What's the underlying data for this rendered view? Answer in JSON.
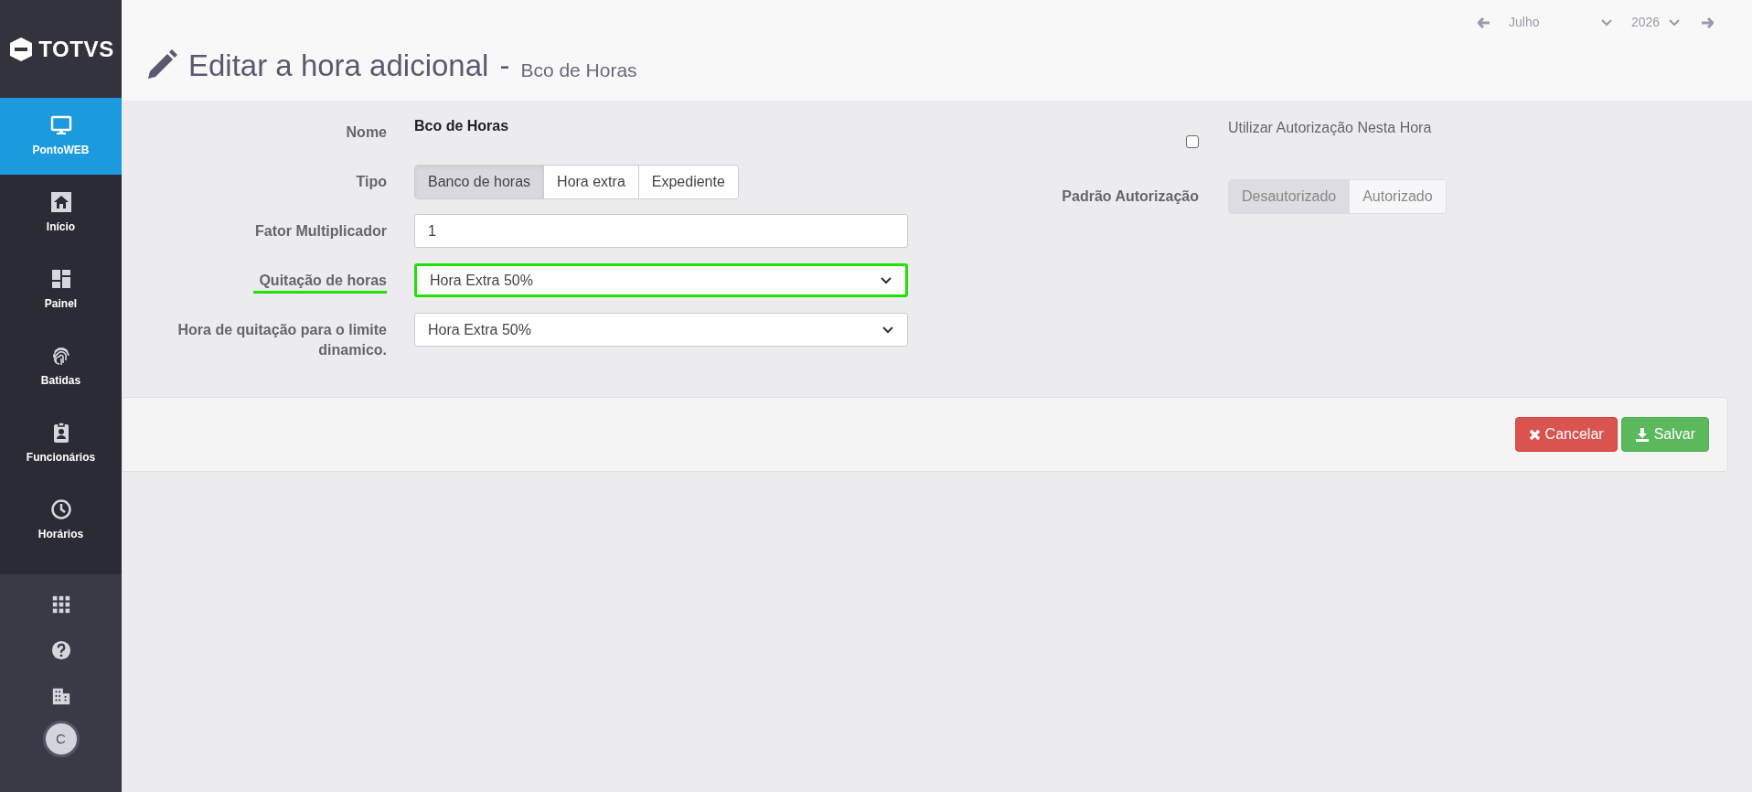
{
  "sidebar": {
    "logo": "TOTVS",
    "items": [
      {
        "label": "PontoWEB",
        "kind": "monitor",
        "selected": true
      },
      {
        "label": "Início",
        "kind": "home",
        "selected": false
      },
      {
        "label": "Painel",
        "kind": "dashboard",
        "selected": false
      },
      {
        "label": "Batidas",
        "kind": "fingerprint",
        "selected": false
      },
      {
        "label": "Funcionários",
        "kind": "badge",
        "selected": false
      },
      {
        "label": "Horários",
        "kind": "clock",
        "selected": false
      }
    ],
    "bottom": [
      {
        "kind": "grid"
      },
      {
        "kind": "help"
      },
      {
        "kind": "building"
      }
    ],
    "avatar": "C"
  },
  "period": {
    "month": "Julho",
    "year": "2026"
  },
  "header": {
    "title": "Editar a hora adicional",
    "separator": "-",
    "subtitle": "Bco de Horas"
  },
  "form": {
    "fields": [
      {
        "kind": "text",
        "label": "Nome",
        "value": "Bco de Horas"
      },
      {
        "kind": "segmented",
        "label": "Tipo",
        "options": [
          {
            "label": "Banco de horas",
            "selected": true
          },
          {
            "label": "Hora extra",
            "selected": false
          },
          {
            "label": "Expediente",
            "selected": false
          }
        ]
      },
      {
        "kind": "input",
        "label": "Fator Multiplicador",
        "value": "1"
      },
      {
        "kind": "select",
        "label": "Quitação de horas",
        "value": "Hora Extra 50%",
        "highlighted": true
      },
      {
        "kind": "select",
        "label": "Hora de quitação para o limite dinamico.",
        "value": "Hora Extra 50%",
        "highlighted": false
      }
    ],
    "authorization": {
      "checkbox_label": "Utilizar Autorização Nesta Hora",
      "checked": false,
      "default_label": "Padrão Autorização",
      "options": [
        {
          "label": "Desautorizado",
          "selected": true
        },
        {
          "label": "Autorizado",
          "selected": false
        }
      ]
    }
  },
  "buttons": [
    {
      "kind": "cancel",
      "label": "Cancelar"
    },
    {
      "kind": "save",
      "label": "Salvar"
    }
  ]
}
